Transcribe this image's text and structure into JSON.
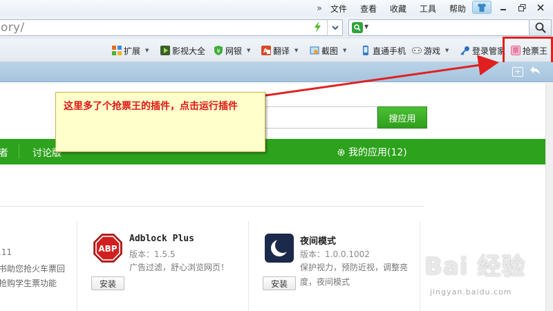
{
  "menubar": {
    "more": "»",
    "items": [
      "文件",
      "查看",
      "收藏",
      "工具",
      "帮助"
    ],
    "skin_icon": "shirt-icon",
    "window_buttons": [
      "restore-icon",
      "maximize-icon"
    ]
  },
  "address": {
    "url_fragment": "ory/",
    "accelerate_icon": "lightning-icon",
    "dropdown_icon": "chevron-down-icon",
    "search_engine_icon": "green-search-engine-icon",
    "search_icon": "magnifier-icon"
  },
  "toolbar": {
    "items": [
      {
        "label": "扩展",
        "icon": "extensions-icon",
        "color": "#e86a1b",
        "caret": true
      },
      {
        "label": "影视大全",
        "icon": "video-icon",
        "color": "#4a8a2a",
        "caret": false
      },
      {
        "label": "网银",
        "icon": "bank-shield-icon",
        "color": "#3fae3a",
        "caret": true
      },
      {
        "label": "翻译",
        "icon": "translate-icon",
        "color": "#d84a2a",
        "caret": true
      },
      {
        "label": "截图",
        "icon": "screenshot-icon",
        "color": "#3b78c4",
        "caret": true
      },
      {
        "label": "直通手机",
        "icon": "phone-icon",
        "color": "#3a78c9",
        "caret": false
      },
      {
        "label": "游戏",
        "icon": "gamepad-icon",
        "color": "#777777",
        "caret": true
      },
      {
        "label": "登录管家",
        "icon": "key-icon",
        "color": "#2a6fc2",
        "caret": false
      },
      {
        "label": "抢票王",
        "icon": "ticket-icon",
        "color": "#e85e8e",
        "caret": false
      }
    ]
  },
  "tabstrip": {
    "new_tab_icon": "new-window-icon",
    "back_icon": "undo-arrow-icon"
  },
  "page": {
    "search_button": "搜应用",
    "nav": {
      "fragment": "者",
      "forum": "讨论版",
      "my_apps": "我的应用(12)"
    },
    "left_app": {
      "version_fragment": ".11",
      "desc_line1": "书助您抢火车票回",
      "desc_line2": "抢购学生票功能"
    },
    "apps": [
      {
        "name": "Adblock Plus",
        "version": "版本：1.5.5",
        "desc": "广告过滤，舒心浏览网页！",
        "install": "安装",
        "icon": "abp-stop-sign-icon",
        "icon_text": "ABP",
        "icon_color": "#cf1f1f"
      },
      {
        "name": "夜间模式",
        "version": "版本：1.0.0.1002",
        "desc_line1": "保护视力，预防近视，调整亮",
        "desc_line2": "度，夜间模式",
        "install": "安装",
        "icon": "crescent-moon-icon",
        "icon_color": "#1b2a4a"
      }
    ]
  },
  "callout": {
    "text": "这里多了个抢票王的插件，点击运行插件"
  },
  "watermark": {
    "title": "Bai 经验",
    "url": "jingyan.baidu.com"
  },
  "colors": {
    "accent_green": "#2da21c",
    "highlight_red": "#e02020",
    "callout_bg": "#ffffcc"
  }
}
